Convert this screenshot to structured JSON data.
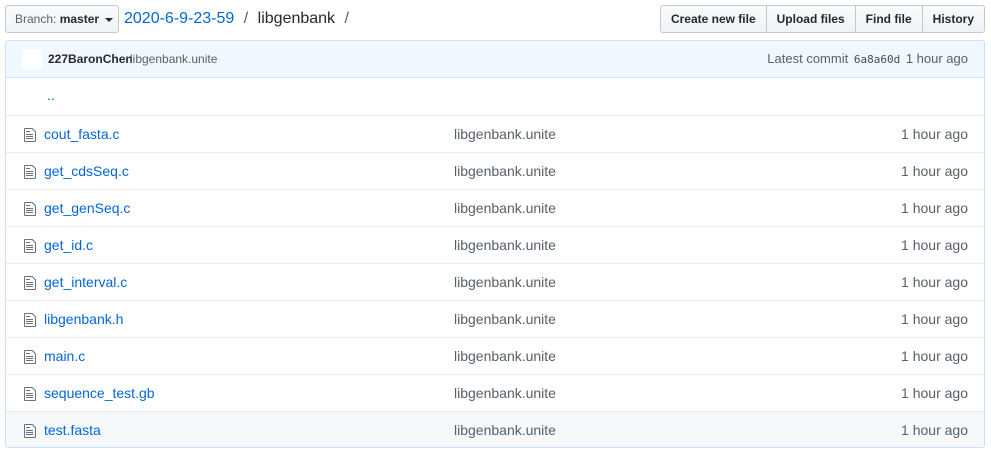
{
  "branch": {
    "prefix": "Branch:",
    "name": "master"
  },
  "breadcrumb": {
    "repo": "2020-6-9-23-59",
    "sep1": "/",
    "dir": "libgenbank",
    "sep2": "/"
  },
  "actions": [
    "Create new file",
    "Upload files",
    "Find file",
    "History"
  ],
  "commit": {
    "author": "227BaronChen",
    "message": "libgenbank.unite",
    "latest_label": "Latest commit",
    "sha": "6a8a60d",
    "age": "1 hour ago"
  },
  "parent_link": "..",
  "files": [
    {
      "name": "cout_fasta.c",
      "message": "libgenbank.unite",
      "age": "1 hour ago",
      "icon": "file-icon"
    },
    {
      "name": "get_cdsSeq.c",
      "message": "libgenbank.unite",
      "age": "1 hour ago",
      "icon": "file-icon"
    },
    {
      "name": "get_genSeq.c",
      "message": "libgenbank.unite",
      "age": "1 hour ago",
      "icon": "file-icon"
    },
    {
      "name": "get_id.c",
      "message": "libgenbank.unite",
      "age": "1 hour ago",
      "icon": "file-icon"
    },
    {
      "name": "get_interval.c",
      "message": "libgenbank.unite",
      "age": "1 hour ago",
      "icon": "file-icon"
    },
    {
      "name": "libgenbank.h",
      "message": "libgenbank.unite",
      "age": "1 hour ago",
      "icon": "file-icon"
    },
    {
      "name": "main.c",
      "message": "libgenbank.unite",
      "age": "1 hour ago",
      "icon": "file-icon"
    },
    {
      "name": "sequence_test.gb",
      "message": "libgenbank.unite",
      "age": "1 hour ago",
      "icon": "file-icon"
    },
    {
      "name": "test.fasta",
      "message": "libgenbank.unite",
      "age": "1 hour ago",
      "icon": "file-icon"
    }
  ],
  "colors": {
    "link": "#0366d6",
    "muted": "#586069",
    "commit_bg": "#f1f8ff",
    "border": "#c8e1ff"
  }
}
